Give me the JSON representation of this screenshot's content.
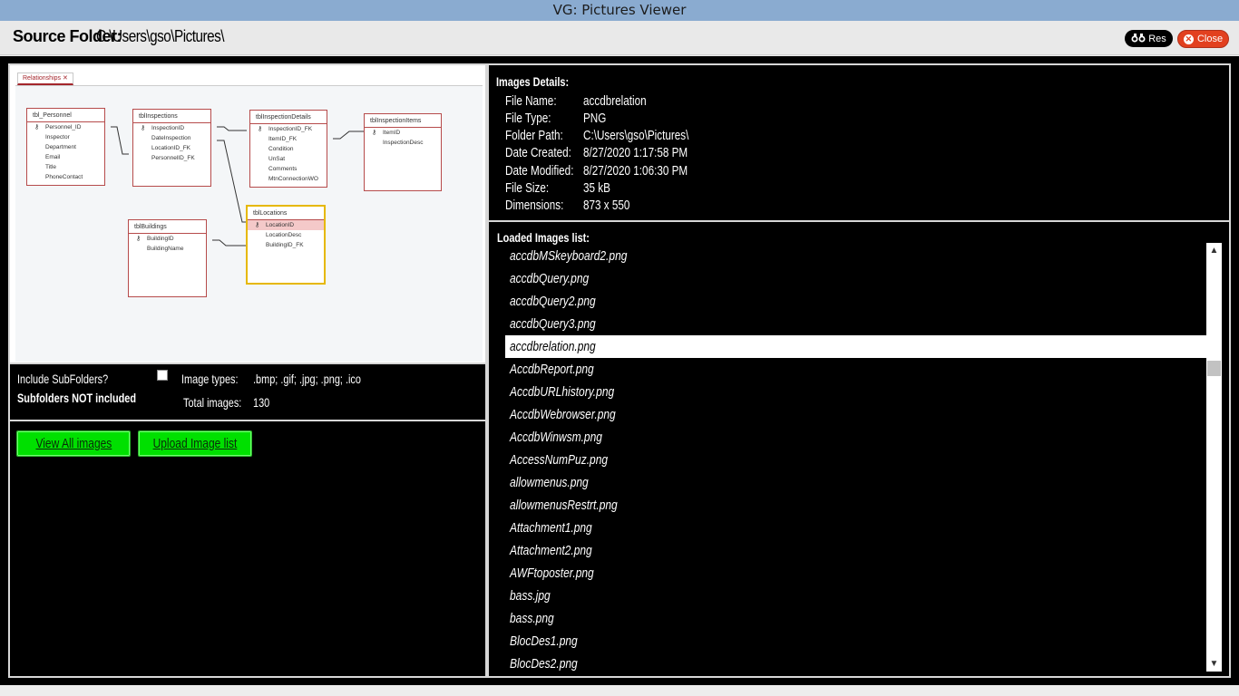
{
  "window": {
    "title": "VG: Pictures Viewer"
  },
  "header": {
    "source_label": "Source Folder:",
    "source_value": "C:\\Users\\gso\\Pictures\\",
    "res_label": "Res",
    "close_label": "Close"
  },
  "preview": {
    "tab_label": "Relationships",
    "tables": [
      {
        "name": "tbl_Personnel",
        "fields": [
          "Personnel_ID",
          "Inspector",
          "Department",
          "Email",
          "Title",
          "PhoneContact"
        ]
      },
      {
        "name": "tblInspections",
        "fields": [
          "InspectionID",
          "DateInspection",
          "LocationID_FK",
          "PersonnelID_FK"
        ]
      },
      {
        "name": "tblInspectionDetails",
        "fields": [
          "InspectionID_FK",
          "ItemID_FK",
          "Condition",
          "UnSat",
          "Comments",
          "MtnConnectionWO"
        ]
      },
      {
        "name": "tblInspectionItems",
        "fields": [
          "ItemID",
          "InspectionDesc"
        ]
      },
      {
        "name": "tblLocations",
        "fields": [
          "LocationID",
          "LocationDesc",
          "BuildingID_FK"
        ]
      },
      {
        "name": "tblBuildings",
        "fields": [
          "BuildingID",
          "BuildingName"
        ]
      }
    ]
  },
  "options": {
    "include_subfolders_label": "Include SubFolders?",
    "subfolders_status": "Subfolders NOT included",
    "image_types_label": "Image types:",
    "image_types_value": ".bmp; .gif; .jpg; .png; .ico",
    "total_images_label": "Total images:",
    "total_images_value": "130"
  },
  "buttons": {
    "view_all": "View All images",
    "upload_list": "Upload Image list"
  },
  "details": {
    "title": "Images Details:",
    "rows": [
      {
        "label": "File Name:",
        "value": "accdbrelation"
      },
      {
        "label": "File Type:",
        "value": "PNG"
      },
      {
        "label": "Folder Path:",
        "value": "C:\\Users\\gso\\Pictures\\"
      },
      {
        "label": "Date Created:",
        "value": "8/27/2020 1:17:58 PM"
      },
      {
        "label": "Date Modified:",
        "value": "8/27/2020 1:06:30 PM"
      },
      {
        "label": "File Size:",
        "value": "35 kB"
      },
      {
        "label": "Dimensions:",
        "value": "873 x 550"
      }
    ]
  },
  "list": {
    "title": "Loaded Images list:",
    "items": [
      "accdbMSkeyboard2.png",
      "accdbQuery.png",
      "accdbQuery2.png",
      "accdbQuery3.png",
      "accdbrelation.png",
      "AccdbReport.png",
      "AccdbURLhistory.png",
      "AccdbWebrowser.png",
      "AccdbWinwsm.png",
      "AccessNumPuz.png",
      "allowmenus.png",
      "allowmenusRestrt.png",
      "Attachment1.png",
      "Attachment2.png",
      "AWFtoposter.png",
      "bass.jpg",
      "bass.png",
      "BlocDes1.png",
      "BlocDes2.png"
    ],
    "selected_index": 4
  },
  "colors": {
    "titlebar": "#8aabd0",
    "button_green": "#00e000",
    "close_red": "#e2401f"
  }
}
